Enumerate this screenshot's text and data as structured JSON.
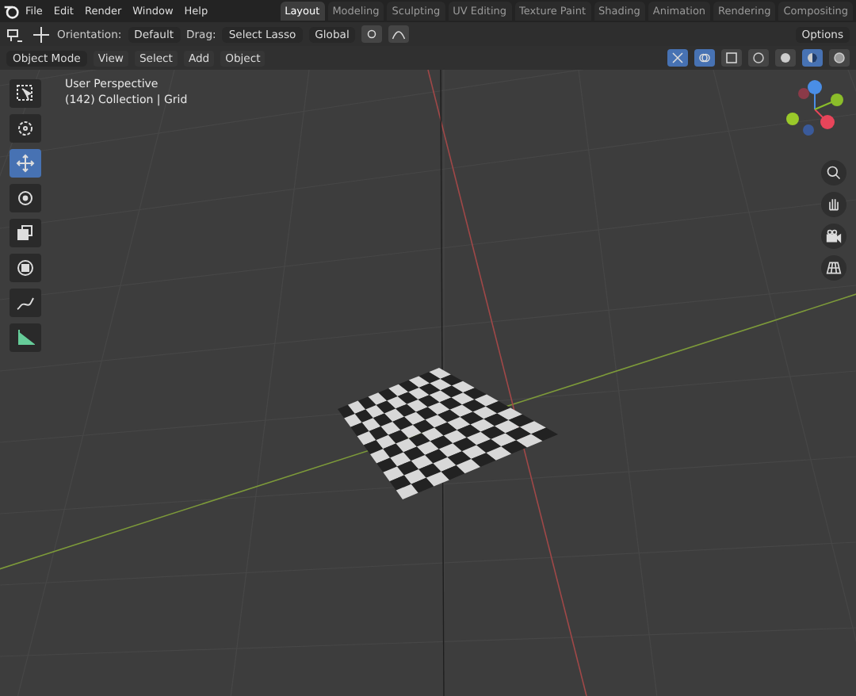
{
  "menu": [
    "File",
    "Edit",
    "Render",
    "Window",
    "Help"
  ],
  "workspaces": [
    {
      "label": "Layout",
      "selected": true
    },
    {
      "label": "Modeling",
      "selected": false
    },
    {
      "label": "Sculpting",
      "selected": false
    },
    {
      "label": "UV Editing",
      "selected": false
    },
    {
      "label": "Texture Paint",
      "selected": false
    },
    {
      "label": "Shading",
      "selected": false
    },
    {
      "label": "Animation",
      "selected": false
    },
    {
      "label": "Rendering",
      "selected": false
    },
    {
      "label": "Compositing",
      "selected": false
    }
  ],
  "tool_header": {
    "orientation_label": "Orientation:",
    "orientation": "Default",
    "drag_label": "Drag:",
    "drag": "Select Lasso",
    "transform": "Global",
    "snap": false,
    "proportional": false,
    "options": "Options"
  },
  "viewport_header": {
    "mode": "Object Mode",
    "menus": [
      "View",
      "Select",
      "Add",
      "Object"
    ],
    "gizmos_on": true,
    "overlays_on": true,
    "xray": false,
    "shading": [
      {
        "kind": "wireframe",
        "selected": false
      },
      {
        "kind": "solid",
        "selected": false
      },
      {
        "kind": "material",
        "selected": true
      },
      {
        "kind": "rendered",
        "selected": false
      }
    ]
  },
  "viewport": {
    "view_name": "User Perspective",
    "object_info": "(142) Collection | Grid"
  },
  "tools": [
    {
      "kind": "select",
      "selected": false
    },
    {
      "kind": "cursor",
      "selected": false
    },
    {
      "kind": "move",
      "selected": true
    },
    {
      "kind": "rotate",
      "selected": false
    },
    {
      "kind": "scale",
      "selected": false
    },
    {
      "kind": "transform",
      "selected": false
    },
    {
      "kind": "annotate",
      "selected": false
    },
    {
      "kind": "measure",
      "selected": false
    }
  ]
}
